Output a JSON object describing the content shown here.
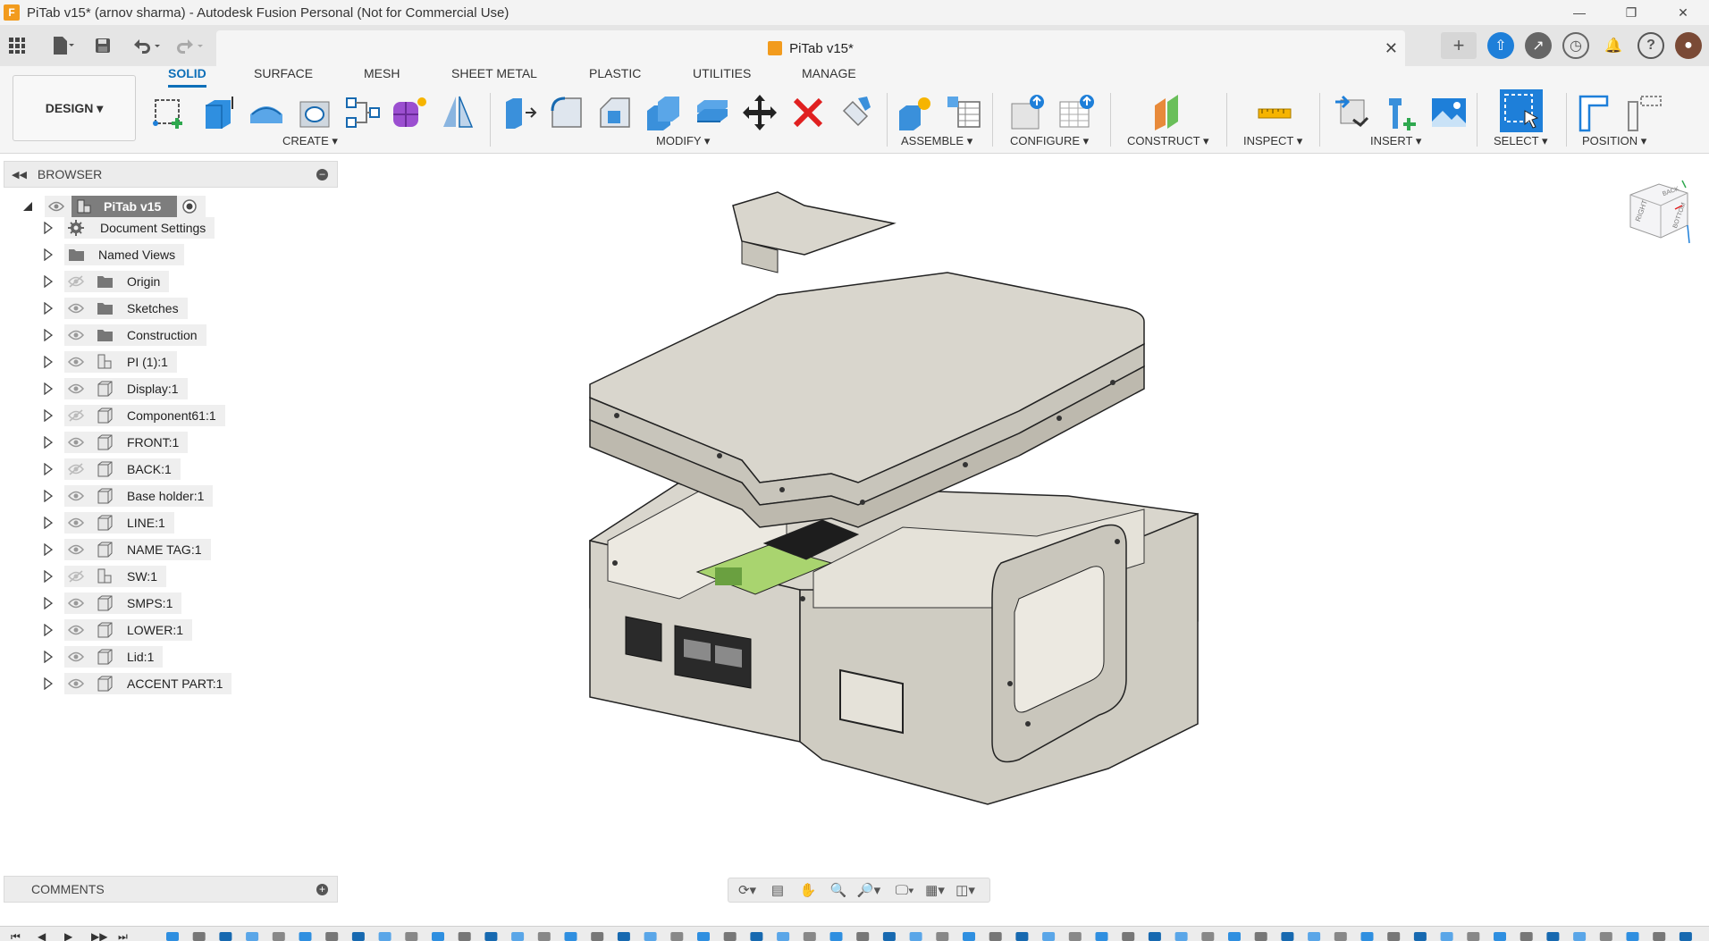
{
  "window": {
    "title": "PiTab v15* (arnov sharma) - Autodesk Fusion Personal (Not for Commercial Use)",
    "app_icon_letter": "F",
    "controls": [
      "—",
      "❐",
      "✕"
    ]
  },
  "document_tab": {
    "label": "PiTab v15*",
    "close": "✕"
  },
  "workspace": {
    "label": "DESIGN ▾"
  },
  "tabs": [
    "SOLID",
    "SURFACE",
    "MESH",
    "SHEET METAL",
    "PLASTIC",
    "UTILITIES",
    "MANAGE"
  ],
  "active_tab": "SOLID",
  "groups": {
    "create": "CREATE ▾",
    "modify": "MODIFY ▾",
    "assemble": "ASSEMBLE ▾",
    "configure": "CONFIGURE ▾",
    "construct": "CONSTRUCT ▾",
    "inspect": "INSPECT ▾",
    "insert": "INSERT ▾",
    "select": "SELECT ▾",
    "position": "POSITION ▾"
  },
  "browser": {
    "title": "BROWSER",
    "root": "PiTab v15",
    "items": [
      {
        "label": "Document Settings",
        "icon": "gear-icon",
        "visible": null
      },
      {
        "label": "Named Views",
        "icon": "folder-icon",
        "visible": null
      },
      {
        "label": "Origin",
        "icon": "folder-icon",
        "visible": false
      },
      {
        "label": "Sketches",
        "icon": "folder-icon",
        "visible": true
      },
      {
        "label": "Construction",
        "icon": "folder-icon",
        "visible": true
      },
      {
        "label": "PI (1):1",
        "icon": "assembly-icon",
        "visible": true
      },
      {
        "label": "Display:1",
        "icon": "component-icon",
        "visible": true
      },
      {
        "label": "Component61:1",
        "icon": "component-icon",
        "visible": false
      },
      {
        "label": "FRONT:1",
        "icon": "component-icon",
        "visible": true
      },
      {
        "label": "BACK:1",
        "icon": "component-icon",
        "visible": false
      },
      {
        "label": "Base holder:1",
        "icon": "component-icon",
        "visible": true
      },
      {
        "label": "LINE:1",
        "icon": "component-icon",
        "visible": true
      },
      {
        "label": "NAME TAG:1",
        "icon": "component-icon",
        "visible": true
      },
      {
        "label": "SW:1",
        "icon": "assembly-icon",
        "visible": false
      },
      {
        "label": "SMPS:1",
        "icon": "component-icon",
        "visible": true
      },
      {
        "label": "LOWER:1",
        "icon": "component-icon",
        "visible": true
      },
      {
        "label": "Lid:1",
        "icon": "component-icon",
        "visible": true
      },
      {
        "label": "ACCENT PART:1",
        "icon": "component-icon",
        "visible": true
      }
    ]
  },
  "comments": {
    "title": "COMMENTS"
  },
  "viewcube": {
    "labels": [
      "RIGHT",
      "BACK",
      "BOTTOM"
    ]
  },
  "colors": {
    "accent": "#0d6fb8",
    "model_body": "#d9d6cd",
    "model_shadow": "#bdb9ae",
    "pcb": "#a9d46f",
    "fusion_orange": "#f29b1d"
  }
}
